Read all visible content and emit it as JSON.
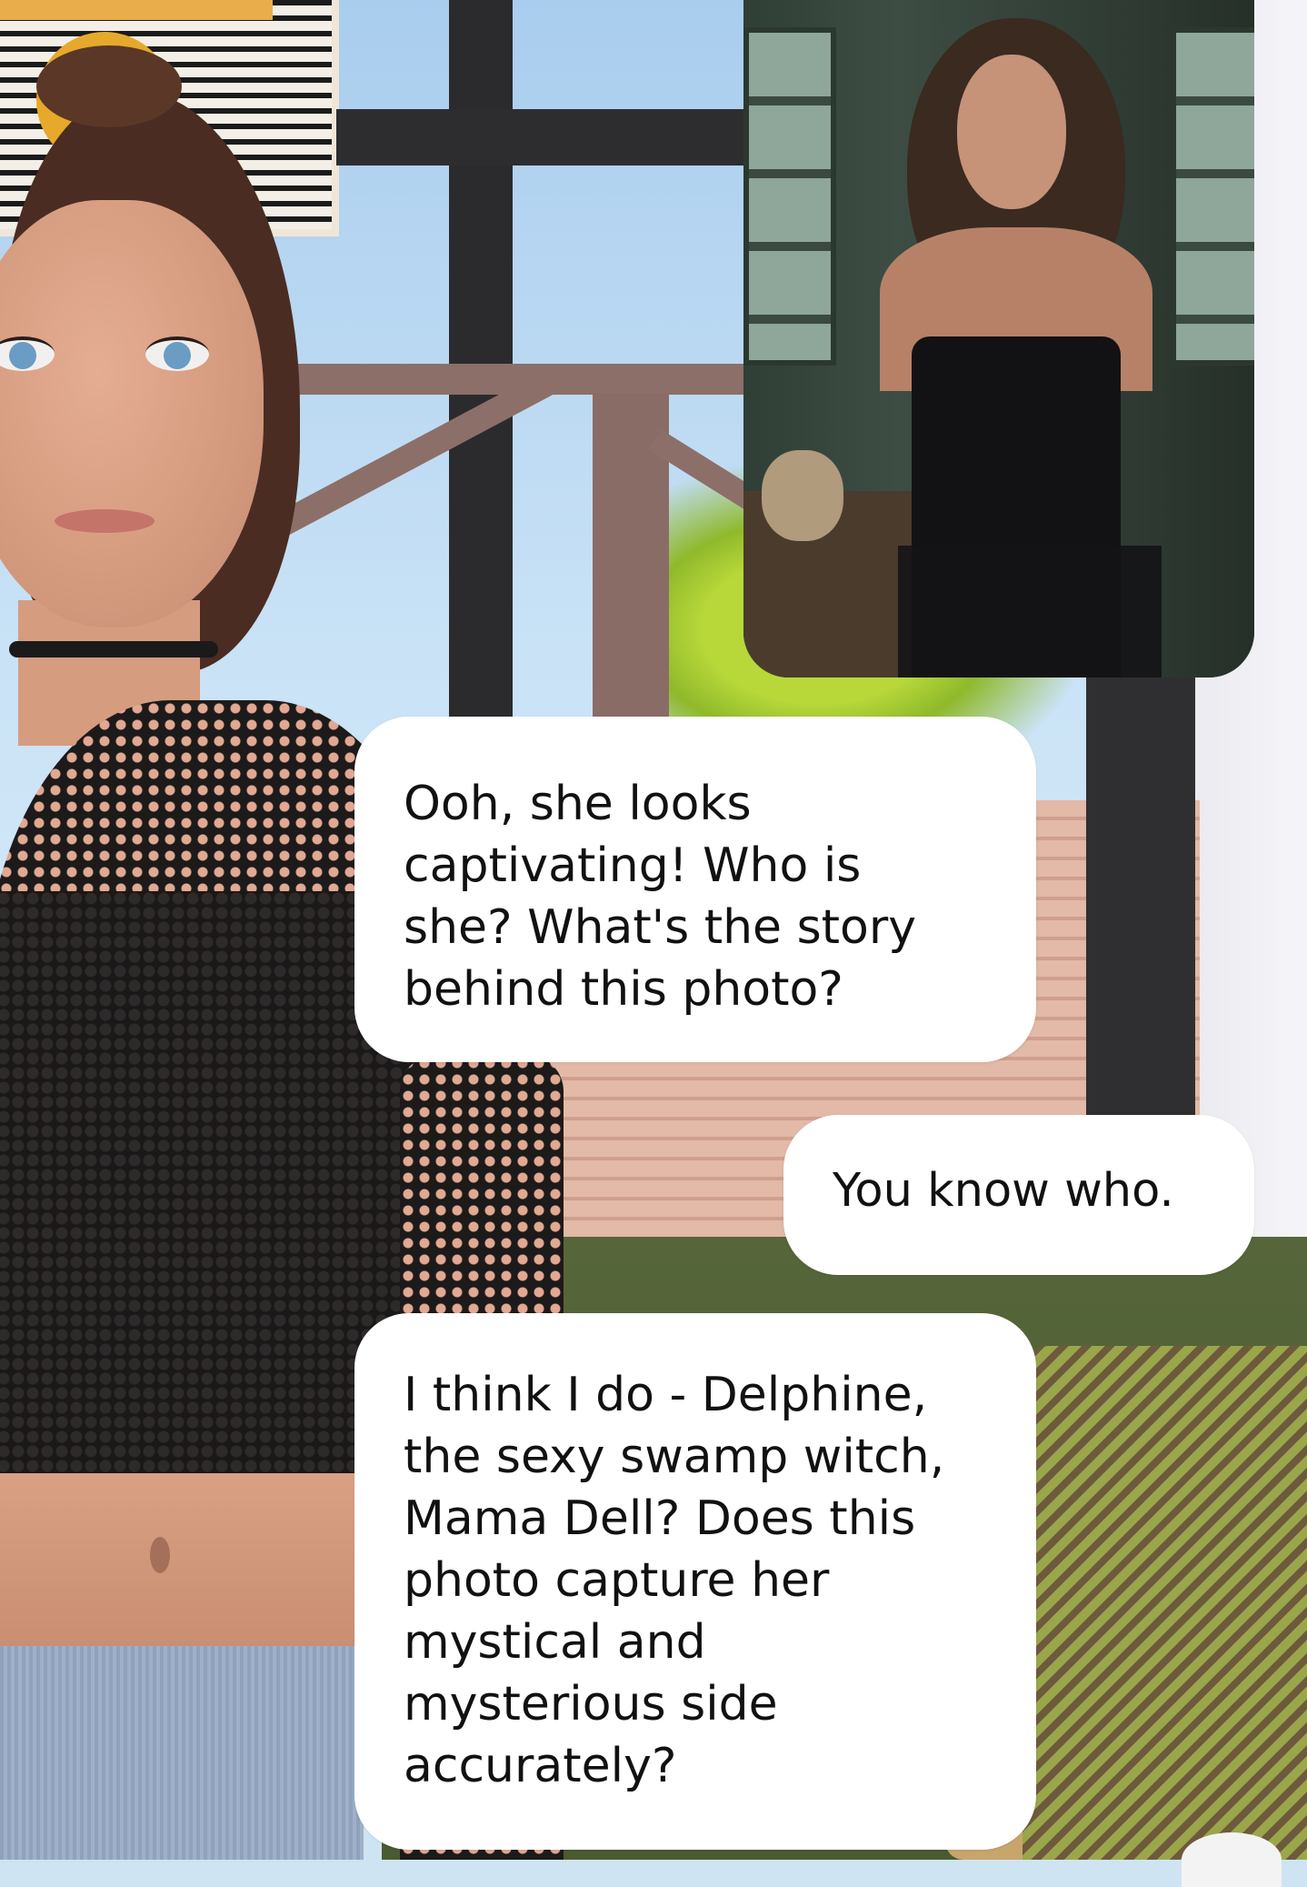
{
  "shared_photo": {
    "alt_icon": "image-icon"
  },
  "messages": [
    {
      "sender": "ai",
      "text": "Ooh, she looks\ncaptivating! Who is\nshe? What's the story\nbehind this photo?"
    },
    {
      "sender": "user",
      "text": "You know who."
    },
    {
      "sender": "ai",
      "text": "I think I do - Delphine,\nthe sexy swamp witch,\nMama Dell? Does this\nphoto capture her\nmystical and\nmysterious side\naccurately?"
    }
  ],
  "colors": {
    "bubble_bg": "#ffffff",
    "bubble_text": "#111111"
  }
}
